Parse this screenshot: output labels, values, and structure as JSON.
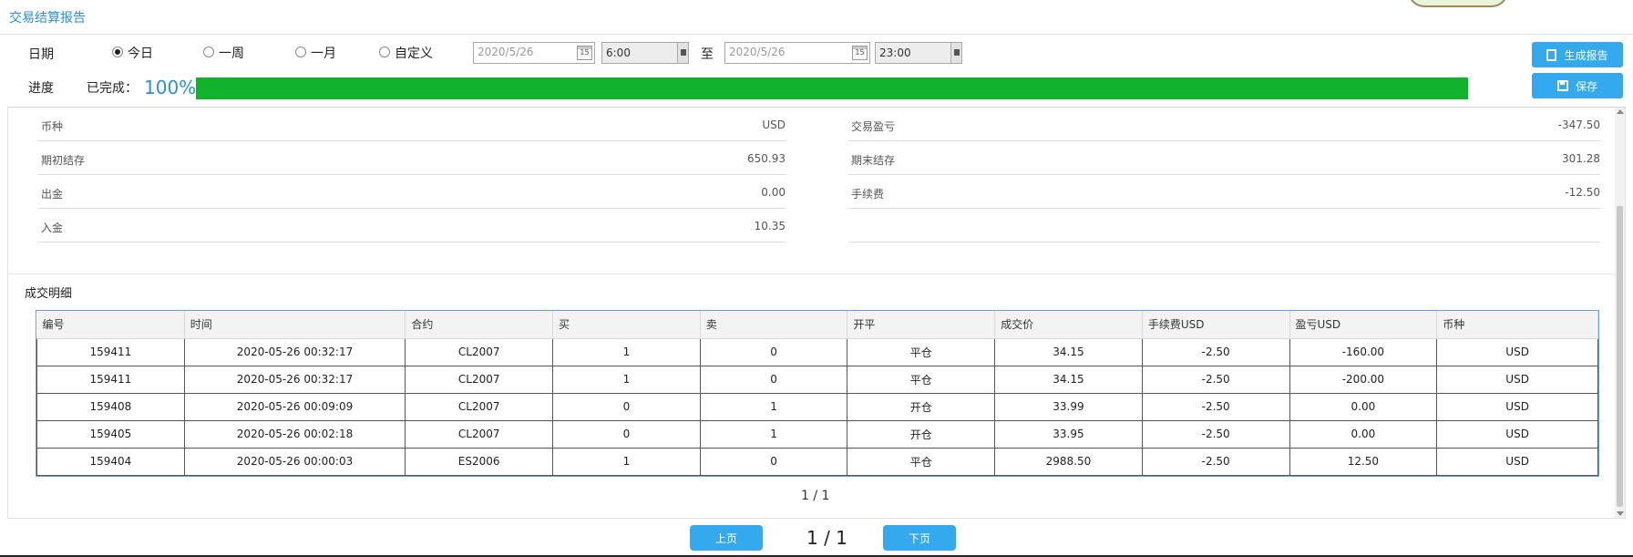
{
  "app": {
    "title": "交易结算报告"
  },
  "date_row": {
    "label": "日期",
    "options": [
      {
        "label": "今日",
        "checked": true
      },
      {
        "label": "一周",
        "checked": false
      },
      {
        "label": "一月",
        "checked": false
      },
      {
        "label": "自定义",
        "checked": false
      }
    ],
    "start_date": "2020/5/26",
    "start_time": "6:00",
    "separator": "至",
    "end_date": "2020/5/26",
    "end_time": "23:00"
  },
  "progress_row": {
    "label": "进度",
    "done_label": "已完成：",
    "percent_text": "100%",
    "percent": 100
  },
  "buttons": {
    "generate": "生成报告",
    "save": "保存"
  },
  "summary": {
    "left": [
      {
        "key": "币种",
        "value": "USD"
      },
      {
        "key": "期初结存",
        "value": "650.93"
      },
      {
        "key": "出金",
        "value": "0.00"
      },
      {
        "key": "入金",
        "value": "10.35"
      }
    ],
    "right": [
      {
        "key": "交易盈亏",
        "value": "-347.50"
      },
      {
        "key": "期末结存",
        "value": "301.28"
      },
      {
        "key": "手续费",
        "value": "-12.50"
      }
    ]
  },
  "details": {
    "title": "成交明细",
    "columns": [
      "编号",
      "时间",
      "合约",
      "买",
      "卖",
      "开平",
      "成交价",
      "手续费USD",
      "盈亏USD",
      "币种"
    ],
    "rows": [
      [
        "159411",
        "2020-05-26 00:32:17",
        "CL2007",
        "1",
        "0",
        "平仓",
        "34.15",
        "-2.50",
        "-160.00",
        "USD"
      ],
      [
        "159411",
        "2020-05-26 00:32:17",
        "CL2007",
        "1",
        "0",
        "平仓",
        "34.15",
        "-2.50",
        "-200.00",
        "USD"
      ],
      [
        "159408",
        "2020-05-26 00:09:09",
        "CL2007",
        "0",
        "1",
        "开仓",
        "33.99",
        "-2.50",
        "0.00",
        "USD"
      ],
      [
        "159405",
        "2020-05-26 00:02:18",
        "CL2007",
        "0",
        "1",
        "开仓",
        "33.95",
        "-2.50",
        "0.00",
        "USD"
      ],
      [
        "159404",
        "2020-05-26 00:00:03",
        "ES2006",
        "1",
        "0",
        "平仓",
        "2988.50",
        "-2.50",
        "12.50",
        "USD"
      ]
    ],
    "page_text": "1 / 1"
  },
  "pager": {
    "prev": "上页",
    "next": "下页",
    "page_text": "1 / 1"
  }
}
